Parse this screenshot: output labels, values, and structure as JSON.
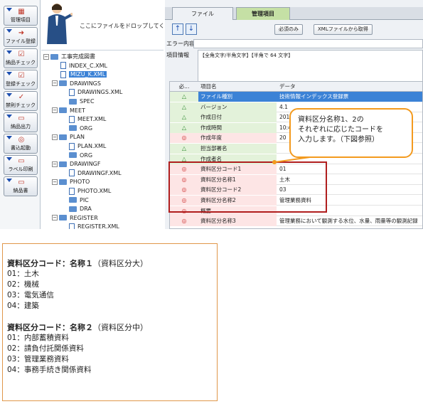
{
  "toolbar": [
    {
      "label": "管理項目",
      "icon": "list-icon",
      "glyph": "▦"
    },
    {
      "label": "ファイル登録",
      "icon": "arrow-icon",
      "glyph": "➜"
    },
    {
      "label": "納品チェック",
      "icon": "check-icon",
      "glyph": "☑"
    },
    {
      "label": "登録チェック",
      "icon": "check-icon",
      "glyph": "☑"
    },
    {
      "label": "禁則チェック",
      "icon": "check-icon",
      "glyph": "✓"
    },
    {
      "label": "納品出力",
      "icon": "printer-icon",
      "glyph": "▭"
    },
    {
      "label": "書込起動",
      "icon": "disc-icon",
      "glyph": "◎"
    },
    {
      "label": "ラベル印刷",
      "icon": "printer-icon",
      "glyph": "▭"
    },
    {
      "label": "納品書",
      "icon": "printer-icon",
      "glyph": "▭"
    }
  ],
  "drop_text": "ここにファイルをドロップしてください",
  "tree": [
    {
      "label": "工事完成図書",
      "type": "folder",
      "level": 0,
      "expander": "−"
    },
    {
      "label": "INDEX_C.XML",
      "type": "file",
      "level": 1
    },
    {
      "label": "MIZU_K.XML",
      "type": "file",
      "level": 1,
      "selected": true
    },
    {
      "label": "DRAWINGS",
      "type": "folder",
      "level": 1,
      "expander": "−"
    },
    {
      "label": "DRAWINGS.XML",
      "type": "file",
      "level": 2
    },
    {
      "label": "SPEC",
      "type": "folder",
      "level": 2
    },
    {
      "label": "MEET",
      "type": "folder",
      "level": 1,
      "expander": "−"
    },
    {
      "label": "MEET.XML",
      "type": "file",
      "level": 2
    },
    {
      "label": "ORG",
      "type": "folder",
      "level": 2
    },
    {
      "label": "PLAN",
      "type": "folder",
      "level": 1,
      "expander": "−"
    },
    {
      "label": "PLAN.XML",
      "type": "file",
      "level": 2
    },
    {
      "label": "ORG",
      "type": "folder",
      "level": 2
    },
    {
      "label": "DRAWINGF",
      "type": "folder",
      "level": 1,
      "expander": "−"
    },
    {
      "label": "DRAWINGF.XML",
      "type": "file",
      "level": 2
    },
    {
      "label": "PHOTO",
      "type": "folder",
      "level": 1,
      "expander": "−"
    },
    {
      "label": "PHOTO.XML",
      "type": "file",
      "level": 2
    },
    {
      "label": "PIC",
      "type": "folder",
      "level": 2
    },
    {
      "label": "DRA",
      "type": "folder",
      "level": 2
    },
    {
      "label": "REGISTER",
      "type": "folder",
      "level": 1,
      "expander": "−"
    },
    {
      "label": "REGISTER.XML",
      "type": "file",
      "level": 2
    }
  ],
  "tabs": {
    "file": "ファイル",
    "manage": "管理項目"
  },
  "buttons": {
    "required_only": "必須のみ",
    "get_xml": "XMLファイルから取得"
  },
  "error_label": "エラー内容",
  "info_label": "項目情報",
  "info_text": "【全角文字/半角文字】【半角で 64 文字】",
  "grid": {
    "headers": {
      "mark": "必...",
      "name": "項目名",
      "data": "データ"
    },
    "rows": [
      {
        "mark": "△",
        "kind": "tri",
        "name": "ファイル種別",
        "data": "技術情報インデックス登録票",
        "selected": true
      },
      {
        "mark": "△",
        "kind": "tri",
        "name": "バージョン",
        "data": "4.1"
      },
      {
        "mark": "△",
        "kind": "tri",
        "name": "作成日付",
        "data": "2015"
      },
      {
        "mark": "△",
        "kind": "tri",
        "name": "作成時間",
        "data": "10:4"
      },
      {
        "mark": "◎",
        "kind": "circ",
        "name": "作成年度",
        "data": "20"
      },
      {
        "mark": "△",
        "kind": "tri",
        "name": "担当部署名",
        "data": ""
      },
      {
        "mark": "△",
        "kind": "tri",
        "name": "作成者名",
        "data": ""
      },
      {
        "mark": "◎",
        "kind": "circ",
        "name": "資料区分コード1",
        "data": "01"
      },
      {
        "mark": "◎",
        "kind": "circ",
        "name": "資料区分名称1",
        "data": "土木"
      },
      {
        "mark": "◎",
        "kind": "circ",
        "name": "資料区分コード2",
        "data": "03"
      },
      {
        "mark": "◎",
        "kind": "circ",
        "name": "資料区分名称2",
        "data": "管理業務資料"
      },
      {
        "mark": "◎",
        "kind": "circ",
        "name": "概要",
        "data": ""
      },
      {
        "mark": "◎",
        "kind": "circ",
        "name": "資料区分名称3",
        "data": "管理業務において観測する水位、水量、雨量等の観測記録"
      }
    ]
  },
  "callout": {
    "lines": [
      "資料区分名称1、2の",
      "それぞれに応じたコードを",
      "入力します。（下図参照）"
    ]
  },
  "reference": {
    "section1": {
      "title": "資料区分コード：名称１",
      "subtitle": "（資料区分大）",
      "items": [
        "01：土木",
        "02：機械",
        "03：電気通信",
        "04：建築"
      ]
    },
    "section2": {
      "title": "資料区分コード：名称２",
      "subtitle": "（資料区分中）",
      "items": [
        "01：内部蓄積資料",
        "02：請負付託関係資料",
        "03：管理業務資料",
        "04：事務手続き関係資料"
      ]
    }
  },
  "colors": {
    "accent_orange": "#f39a1e",
    "highlight_red": "#b01e1e",
    "tab_green": "#c5e0a5",
    "selection_blue": "#3b82d6"
  }
}
